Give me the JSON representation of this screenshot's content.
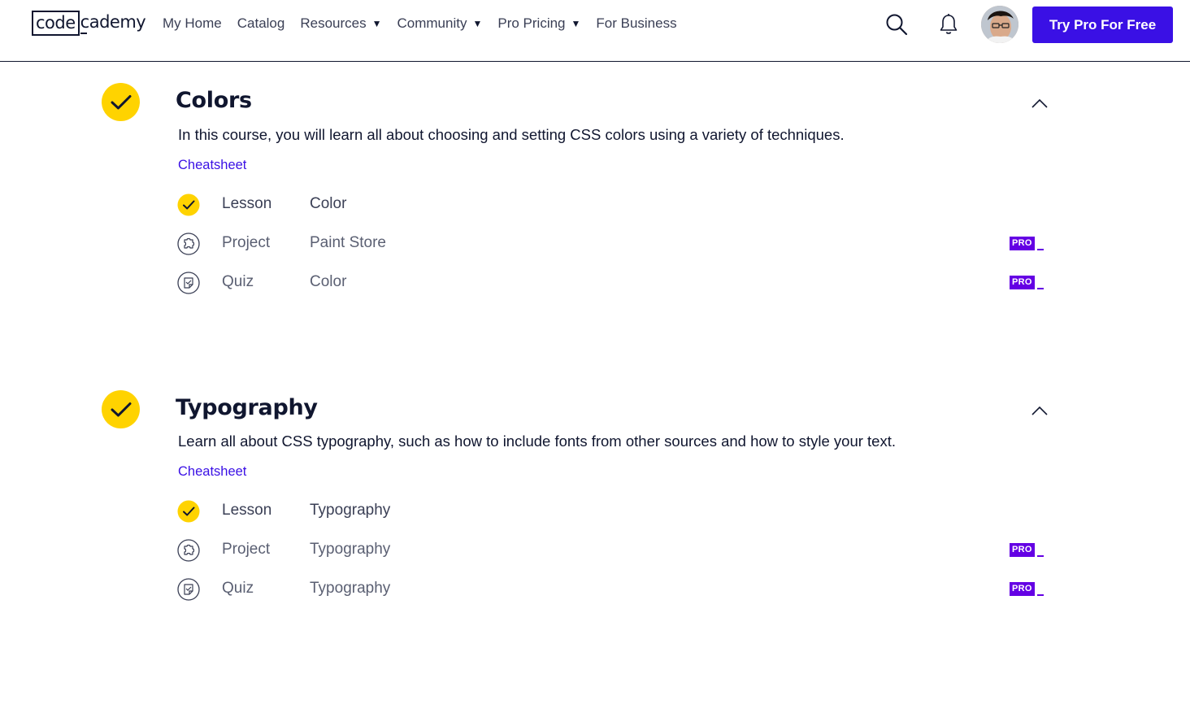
{
  "header": {
    "logo_left": "code",
    "logo_right": "cademy",
    "nav": [
      {
        "label": "My Home",
        "dropdown": false
      },
      {
        "label": "Catalog",
        "dropdown": false
      },
      {
        "label": "Resources",
        "dropdown": true
      },
      {
        "label": "Community",
        "dropdown": true
      },
      {
        "label": "Pro Pricing",
        "dropdown": true
      },
      {
        "label": "For Business",
        "dropdown": false
      }
    ],
    "cta_label": "Try Pro For Free"
  },
  "modules": [
    {
      "title": "Colors",
      "completed": true,
      "expanded": true,
      "description": "In this course, you will learn all about choosing and setting CSS colors using a variety of techniques.",
      "cheatsheet_label": "Cheatsheet",
      "items": [
        {
          "type": "Lesson",
          "name": "Color",
          "icon": "check-icon",
          "completed": true,
          "pro": false
        },
        {
          "type": "Project",
          "name": "Paint Store",
          "icon": "puzzle-icon",
          "completed": false,
          "pro": true
        },
        {
          "type": "Quiz",
          "name": "Color",
          "icon": "quiz-icon",
          "completed": false,
          "pro": true
        }
      ]
    },
    {
      "title": "Typography",
      "completed": true,
      "expanded": true,
      "description": "Learn all about CSS typography, such as how to include fonts from other sources and how to style your text.",
      "cheatsheet_label": "Cheatsheet",
      "items": [
        {
          "type": "Lesson",
          "name": "Typography",
          "icon": "check-icon",
          "completed": true,
          "pro": false
        },
        {
          "type": "Project",
          "name": "Typography",
          "icon": "puzzle-icon",
          "completed": false,
          "pro": true
        },
        {
          "type": "Quiz",
          "name": "Typography",
          "icon": "quiz-icon",
          "completed": false,
          "pro": true
        }
      ]
    }
  ],
  "pro_badge_label": "PRO",
  "colors": {
    "accent": "#3a10e5",
    "check": "#ffd300",
    "pro": "#6400e4",
    "text": "#10162f"
  }
}
